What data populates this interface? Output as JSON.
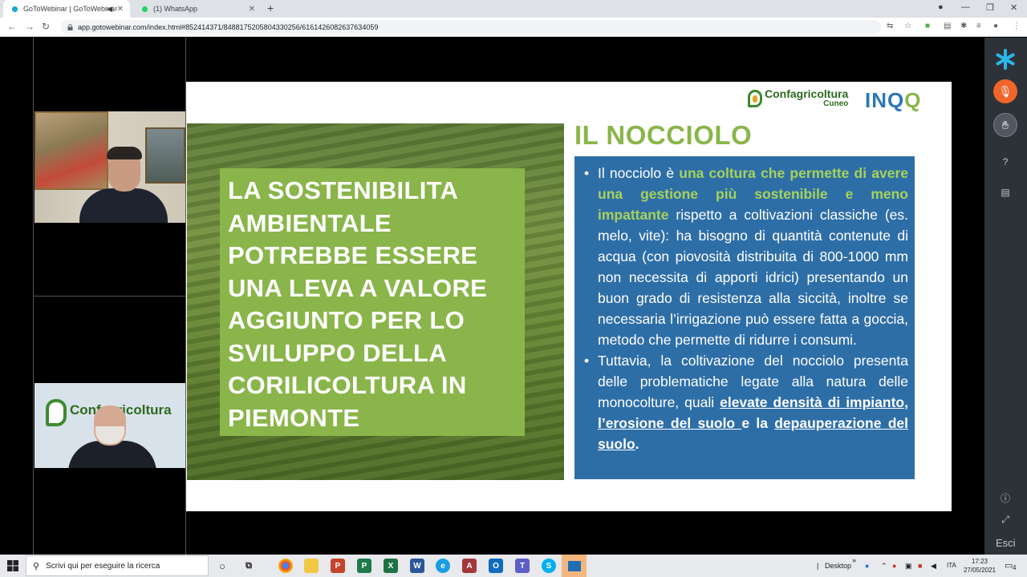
{
  "browser": {
    "tabs": [
      {
        "title": "GoToWebinar | GoToWebinar",
        "active": true
      },
      {
        "title": "(1) WhatsApp",
        "active": false
      }
    ],
    "url": "app.gotowebinar.com/index.html#852414371/8488175205804330256/6161426082637634059"
  },
  "slide": {
    "green_text": "LA SOSTENIBILITA AMBIENTALE POTREBBE ESSERE UNA LEVA A VALORE AGGIUNTO PER LO SVILUPPO DELLA CORILICOLTURA IN PIEMONTE",
    "title": "IL NOCCIOLO",
    "logo_name": "Confagricoltura",
    "logo_sub": "Cuneo",
    "logo2": "INQ",
    "bullet1": {
      "pre": "Il nocciolo è ",
      "highlight": "una coltura che permette di avere una gestione più sostenibile e meno impattante",
      "post": " rispetto a coltivazioni classiche (es. melo, vite): ha bisogno di quantità contenute di acqua (con piovosità distribuita di 800-1000 mm non necessita di apporti idrici) presentando un buon grado di resistenza alla siccità, inoltre se necessaria l’irrigazione può essere fatta a goccia, metodo che permette di ridurre i consumi."
    },
    "bullet2": {
      "pre": "Tuttavia, la coltivazione del nocciolo presenta delle problematiche legate alla natura delle monocolture, quali ",
      "u1": "elevate densità di impianto",
      "sep1": ", ",
      "u2": "l’erosione del suolo ",
      "sep2": "e la ",
      "u3": "depauperazione del suolo",
      "end": "."
    }
  },
  "cams": {
    "cam2_banner": "Confagricoltura"
  },
  "right_panel": {
    "exit_label": "Esci"
  },
  "taskbar": {
    "search_placeholder": "Scrivi qui per eseguire la ricerca",
    "desktop_label": "Desktop",
    "lang": "ITA",
    "time": "17:23",
    "date": "27/05/2021",
    "notif_count": "4"
  },
  "colors": {
    "slide_green": "#8ab54a",
    "slide_blue": "#2e6ea7",
    "mic_orange": "#f0652a",
    "panel_dark": "#2d3239"
  }
}
